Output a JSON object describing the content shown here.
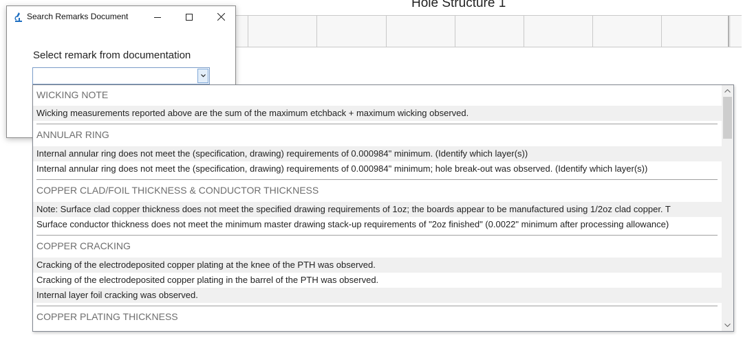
{
  "background": {
    "title": "Hole Structure 1"
  },
  "dialog": {
    "title": "Search Remarks Document",
    "prompt": "Select remark from documentation",
    "combo_value": ""
  },
  "dropdown": {
    "groups": [
      {
        "heading": "WICKING NOTE",
        "items": [
          "Wicking measurements reported above are the sum of the maximum etchback + maximum wicking observed."
        ]
      },
      {
        "heading": "ANNULAR RING",
        "items": [
          "Internal annular ring does not meet the (specification, drawing) requirements of 0.000984\" minimum. (Identify which layer(s))",
          "Internal annular ring does not meet the (specification, drawing) requirements of 0.000984\" minimum; hole break-out was observed. (Identify which layer(s))"
        ]
      },
      {
        "heading": "COPPER CLAD/FOIL THICKNESS & CONDUCTOR THICKNESS",
        "items": [
          "Note: Surface clad copper thickness does not meet the specified drawing requirements of 1oz; the boards appear to be manufactured using 1/2oz clad copper. T",
          "Surface conductor thickness does not meet the minimum master drawing stack-up requirements of \"2oz finished\" (0.0022\" minimum after processing allowance)"
        ]
      },
      {
        "heading": "COPPER CRACKING",
        "items": [
          "Cracking of the electrodeposited copper plating at the knee of the PTH was observed.",
          "Cracking of the electrodeposited copper plating in the barrel of the PTH was observed.",
          "Internal layer foil cracking was observed."
        ]
      },
      {
        "heading": "COPPER PLATING THICKNESS",
        "items": []
      }
    ]
  }
}
